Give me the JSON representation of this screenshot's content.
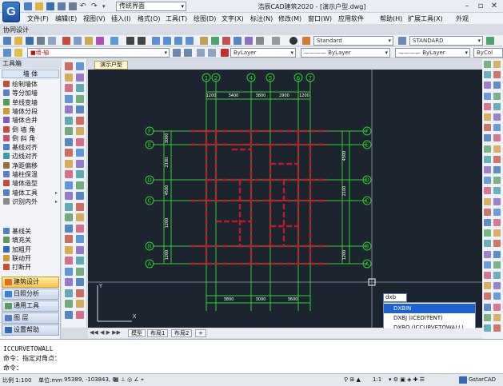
{
  "title_bar": {
    "workspace": "传统界面",
    "app_title": "浩辰CAD建筑2020 - [演示户型.dwg]"
  },
  "menu": [
    "文件(F)",
    "编辑(E)",
    "视图(V)",
    "插入(I)",
    "格式(O)",
    "工具(T)",
    "绘图(D)",
    "文字(X)",
    "标注(N)",
    "修改(M)",
    "窗口(W)",
    "应用软件",
    "帮助(H)",
    "扩展工具(X)",
    "外观"
  ],
  "collab_label": "协同设计",
  "toolbar1": {
    "text_style": "Standard",
    "dim_style": "STANDARD"
  },
  "toolbar2": {
    "layer": "■墙-轴",
    "color": "ByLayer",
    "linetype": "———— ByLayer",
    "lineweight": "———— ByLayer",
    "plot": "ByCol"
  },
  "left_panel": {
    "title": "工具箱",
    "category": "墙  体",
    "items": [
      {
        "label": "绘制墙体",
        "arrow": false
      },
      {
        "label": "等分加墙",
        "arrow": false
      },
      {
        "label": "单线变墙",
        "arrow": false
      },
      {
        "label": "墙体分段",
        "arrow": false
      },
      {
        "label": "墙体合并",
        "arrow": false
      },
      {
        "label": "倒 墙 角",
        "arrow": false
      },
      {
        "label": "倒 斜 角",
        "arrow": false
      },
      {
        "label": "基线对齐",
        "arrow": false
      },
      {
        "label": "边线对齐",
        "arrow": false
      },
      {
        "label": "净距偏移",
        "arrow": false
      },
      {
        "label": "墙柱保温",
        "arrow": false
      },
      {
        "label": "墙体造型",
        "arrow": false
      },
      {
        "label": "墙体工具",
        "arrow": true
      },
      {
        "label": "识别内外",
        "arrow": true
      }
    ],
    "items2": [
      "基线关",
      "填充关",
      "加粗开",
      "联动开",
      "打断开"
    ],
    "cats": [
      "建筑设计",
      "日照分析",
      "通用工具",
      "图    层",
      "设置帮助"
    ]
  },
  "doc_tab": "演示户型",
  "drawing": {
    "top_axes": [
      "1",
      "2",
      "4",
      "5",
      "6",
      "7"
    ],
    "top_dims": [
      "1200",
      "3400",
      "3800",
      "2900",
      "1200"
    ],
    "bottom_dims": [
      "3800",
      "3000",
      "3600"
    ],
    "left_axes": [
      "F",
      "E",
      "D",
      "C",
      "B",
      "A"
    ],
    "left_dims": [
      "3000",
      "2100",
      "4500",
      "1200",
      "1200"
    ],
    "right_dims": [
      "4500",
      "2100",
      "1200"
    ],
    "ucs_y": "Y",
    "ucs_x": "X"
  },
  "autocomplete": {
    "input": "dxb",
    "options": [
      "DXBIN",
      "DXBJ (ICEDITENT)",
      "DXBQ (ICCURVETOWALL)"
    ],
    "selected": 0
  },
  "layout_tabs": [
    "模型",
    "布局1",
    "布局2",
    "+"
  ],
  "command": {
    "lines": [
      "ICCURVETOWALL",
      "命令：指定对角点：",
      "命令："
    ]
  },
  "status": {
    "scale": "比例 1:100",
    "unit": "单位:mm",
    "coords": "95389, -103843, 0",
    "ratio": "1:1",
    "brand": "GstarCAD"
  },
  "colors": {
    "canvas": "#1c2430",
    "axis": "#2fd12f",
    "wall": "#c0192a",
    "accent": "#1e62cf"
  }
}
